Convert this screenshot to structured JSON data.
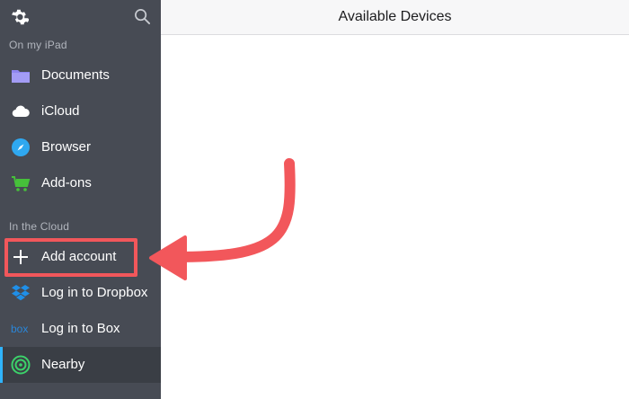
{
  "sidebar": {
    "section_local": "On my iPad",
    "section_cloud": "In the Cloud",
    "local_items": [
      {
        "label": "Documents",
        "icon": "folder-icon",
        "color": "#8e86f0"
      },
      {
        "label": "iCloud",
        "icon": "cloud-icon",
        "color": "#ffffff"
      },
      {
        "label": "Browser",
        "icon": "compass-icon",
        "color": "#2fa8f0"
      },
      {
        "label": "Add-ons",
        "icon": "cart-icon",
        "color": "#46c13a"
      }
    ],
    "cloud_items": [
      {
        "label": "Add account",
        "icon": "plus-icon"
      },
      {
        "label": "Log in to Dropbox",
        "icon": "dropbox-icon",
        "color": "#1f8fe8"
      },
      {
        "label": "Log in to Box",
        "icon": "box-logo-icon",
        "icon_text": "box",
        "color": "#2a86d9"
      },
      {
        "label": "Nearby",
        "icon": "radar-icon",
        "color": "#3cd16a",
        "selected": true
      }
    ]
  },
  "main": {
    "title": "Available Devices"
  },
  "annotation": {
    "color": "#f2575b"
  }
}
